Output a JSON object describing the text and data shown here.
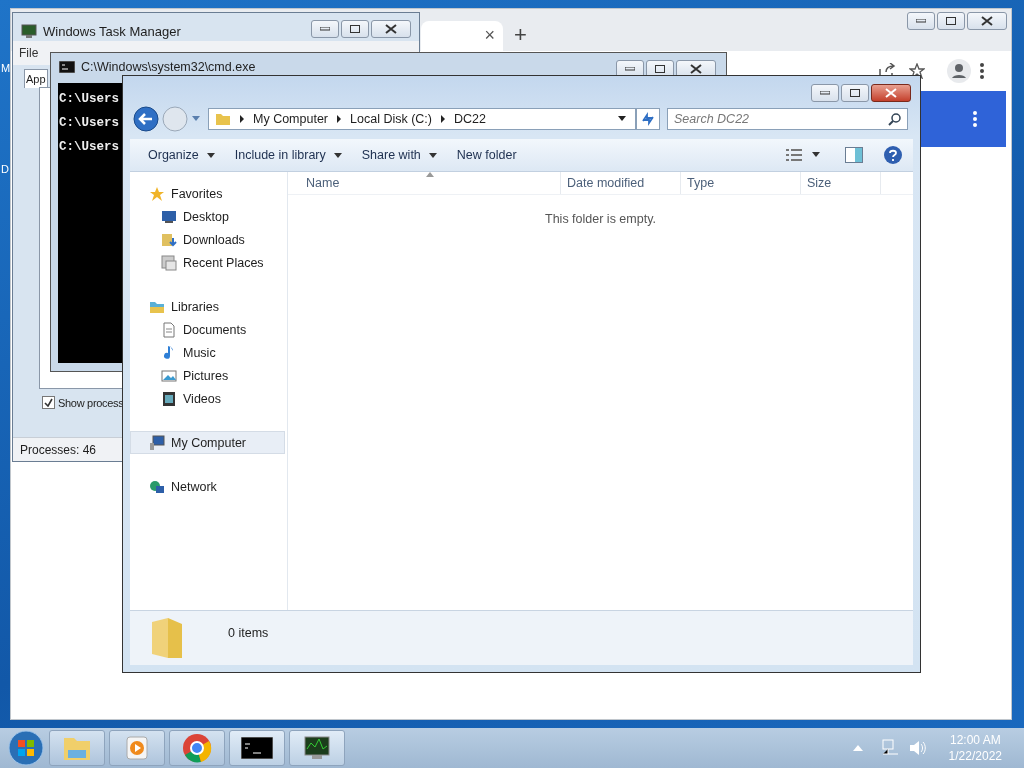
{
  "desktop": {
    "icon_labels": [
      "M",
      "D"
    ]
  },
  "browser": {
    "tab_close": "×",
    "new_tab": "+"
  },
  "task_manager": {
    "title": "Windows Task Manager",
    "menu": [
      "File"
    ],
    "tab": "App",
    "show_processes": {
      "label": "Show process",
      "checked": true
    },
    "status": "Processes: 46"
  },
  "console": {
    "title": "C:\\Windows\\system32\\cmd.exe",
    "lines": [
      "C:\\Users",
      "C:\\Users",
      "C:\\Users"
    ]
  },
  "explorer": {
    "breadcrumbs": [
      "My Computer",
      "Local Disk (C:)",
      "DC22"
    ],
    "search": {
      "placeholder": "Search DC22"
    },
    "toolbar": [
      {
        "label": "Organize",
        "dropdown": true
      },
      {
        "label": "Include in library",
        "dropdown": true
      },
      {
        "label": "Share with",
        "dropdown": true
      },
      {
        "label": "New folder",
        "dropdown": false
      }
    ],
    "columns": [
      "Name",
      "Date modified",
      "Type",
      "Size"
    ],
    "empty_message": "This folder is empty.",
    "nav": [
      {
        "label": "Favorites",
        "selected": false,
        "children": [
          {
            "label": "Desktop",
            "selected": false
          },
          {
            "label": "Downloads",
            "selected": false
          },
          {
            "label": "Recent Places",
            "selected": false
          }
        ]
      },
      {
        "label": "Libraries",
        "selected": false,
        "children": [
          {
            "label": "Documents",
            "selected": false
          },
          {
            "label": "Music",
            "selected": false
          },
          {
            "label": "Pictures",
            "selected": false
          },
          {
            "label": "Videos",
            "selected": false
          }
        ]
      },
      {
        "label": "My Computer",
        "selected": true
      },
      {
        "label": "Network",
        "selected": false
      }
    ],
    "status": "0 items"
  },
  "taskbar": {
    "time": "12:00 AM",
    "date": "1/22/2022"
  }
}
